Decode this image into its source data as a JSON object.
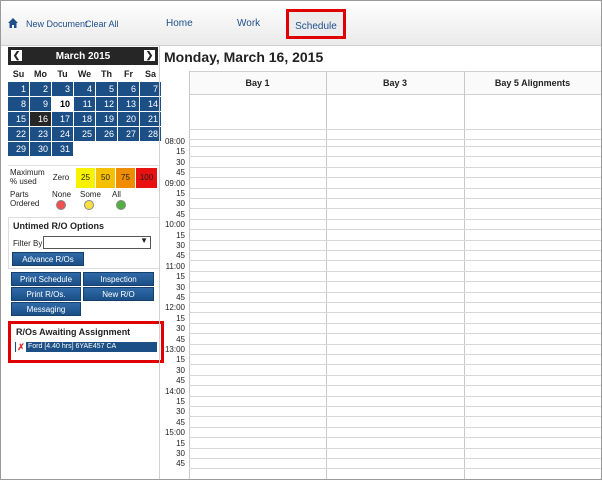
{
  "nav": {
    "new_document": "New Document",
    "clear_all": "Clear All",
    "tabs": [
      "Home",
      "Work",
      "Schedule"
    ],
    "active_tab": "Schedule"
  },
  "calendar": {
    "title": "March 2015",
    "prev_icon": "prev-month-icon",
    "next_icon": "next-month-icon",
    "dow": [
      "Su",
      "Mo",
      "Tu",
      "We",
      "Th",
      "Fr",
      "Sa"
    ],
    "weeks": [
      [
        "1",
        "2",
        "3",
        "4",
        "5",
        "6",
        "7"
      ],
      [
        "8",
        "9",
        "10",
        "11",
        "12",
        "13",
        "14"
      ],
      [
        "15",
        "16",
        "17",
        "18",
        "19",
        "20",
        "21"
      ],
      [
        "22",
        "23",
        "24",
        "25",
        "26",
        "27",
        "28"
      ],
      [
        "29",
        "30",
        "31",
        "",
        "",
        "",
        ""
      ]
    ],
    "today": "10",
    "selected": "16"
  },
  "legend": {
    "max_label": "Maximum % used",
    "pct_levels": [
      "Zero",
      "25",
      "50",
      "75",
      "100"
    ],
    "pct_colors": [
      "#ffffff",
      "#f8f200",
      "#f5c000",
      "#f08c00",
      "#e81010"
    ],
    "parts_label": "Parts Ordered",
    "parts_levels": [
      "None",
      "Some",
      "All"
    ],
    "parts_colors": [
      "#f05050",
      "#f8e040",
      "#50b040"
    ]
  },
  "untimed": {
    "title": "Untimed R/O Options",
    "filter_label": "Filter By",
    "filter_value": "",
    "advance_button": "Advance R/Os"
  },
  "actions": {
    "print_schedule": "Print Schedule",
    "inspection": "Inspection",
    "print_ros": "Print R/Os.",
    "new_ro": "New R/O",
    "messaging": "Messaging"
  },
  "awaiting": {
    "title": "R/Os Awaiting Assignment",
    "items": [
      "Ford [4.40 hrs] 6YAE457 CA"
    ]
  },
  "schedule": {
    "date_title": "Monday, March 16, 2015",
    "bays": [
      "Bay 1",
      "Bay 3",
      "Bay 5 Alignments"
    ],
    "times": [
      "08:00",
      "15",
      "30",
      "45",
      "09:00",
      "15",
      "30",
      "45",
      "10:00",
      "15",
      "30",
      "45",
      "11:00",
      "15",
      "30",
      "45",
      "12:00",
      "15",
      "30",
      "45",
      "13:00",
      "15",
      "30",
      "45",
      "14:00",
      "15",
      "30",
      "45",
      "15:00",
      "15",
      "30",
      "45"
    ]
  }
}
